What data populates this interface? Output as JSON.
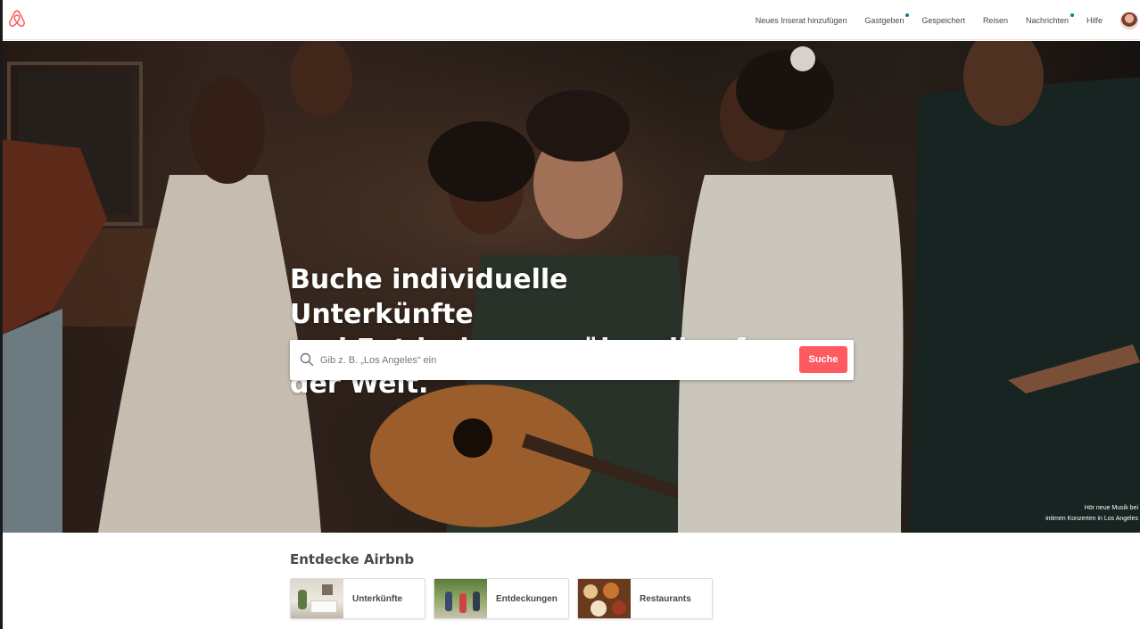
{
  "header": {
    "logo": "airbnb-logo",
    "nav": [
      {
        "label": "Neues Inserat hinzufügen",
        "dot": false
      },
      {
        "label": "Gastgeben",
        "dot": true
      },
      {
        "label": "Gespeichert",
        "dot": false
      },
      {
        "label": "Reisen",
        "dot": false
      },
      {
        "label": "Nachrichten",
        "dot": true
      },
      {
        "label": "Hilfe",
        "dot": false
      }
    ],
    "accent_color": "#008489"
  },
  "hero": {
    "title_line1": "Buche individuelle Unterkünfte",
    "title_line2": "und Entdeckungen überall auf",
    "title_line3": "der Welt.",
    "search": {
      "placeholder": "Gib z. B. „Los Angeles“ ein",
      "value": "",
      "button_label": "Suche",
      "button_color": "#ff5a5f"
    },
    "caption_line1": "Hör neue Musik bei",
    "caption_line2": "intimen Konzerten in Los Angeles"
  },
  "explore": {
    "title": "Entdecke Airbnb",
    "cards": [
      {
        "label": "Unterkünfte"
      },
      {
        "label": "Entdeckungen"
      },
      {
        "label": "Restaurants"
      }
    ]
  }
}
